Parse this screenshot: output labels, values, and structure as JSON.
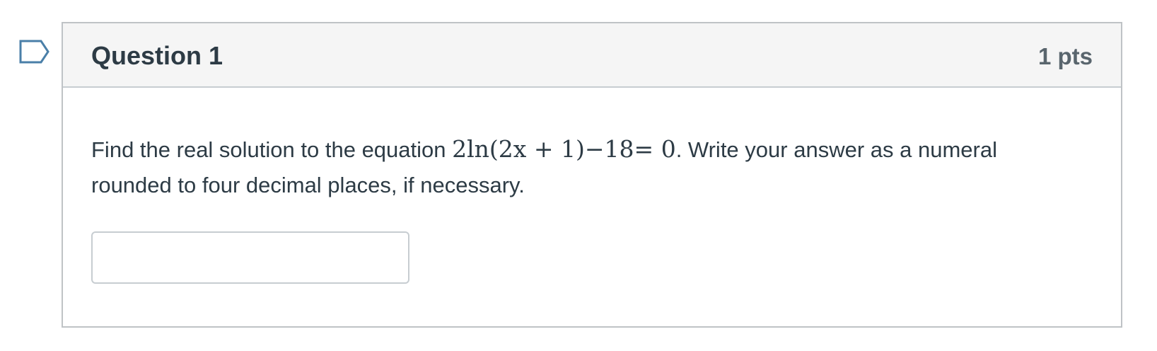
{
  "question": {
    "title": "Question 1",
    "points": "1 pts",
    "text_before": "Find the real solution to the equation ",
    "equation": "2ln(2x + 1)−18= 0",
    "text_after": ". Write your answer as a numeral rounded to four decimal places, if necessary.",
    "answer_value": "",
    "flag_icon": "bookmark-flag-icon"
  },
  "colors": {
    "header_background": "#f5f5f5",
    "border": "#bfc3c6",
    "text": "#2d3b45",
    "flag": "#4a7fa8"
  }
}
